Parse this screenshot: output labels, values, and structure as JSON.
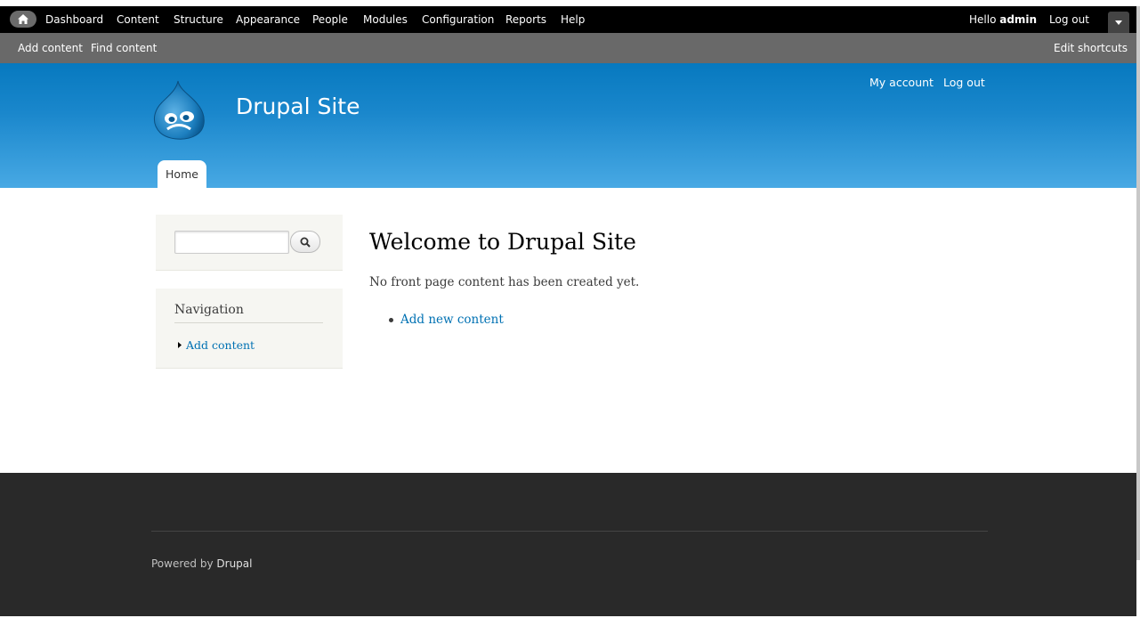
{
  "toolbar": {
    "menu": [
      "Dashboard",
      "Content",
      "Structure",
      "Appearance",
      "People",
      "Modules",
      "Configuration",
      "Reports",
      "Help"
    ],
    "hello_prefix": "Hello ",
    "user": "admin",
    "logout": "Log out"
  },
  "shortcuts": {
    "add_content": "Add content",
    "find_content": "Find content",
    "edit_shortcuts": "Edit shortcuts"
  },
  "header": {
    "site_name": "Drupal Site",
    "my_account": "My account",
    "logout": "Log out",
    "tab_home": "Home"
  },
  "sidebar": {
    "search_value": "",
    "navigation_title": "Navigation",
    "navigation_items": [
      "Add content"
    ]
  },
  "content": {
    "title": "Welcome to Drupal Site",
    "message": "No front page content has been created yet.",
    "link": "Add new content"
  },
  "footer": {
    "powered_by": "Powered by",
    "drupal": "Drupal"
  },
  "colors": {
    "toolbar": "#000000",
    "shortcuts": "#696969",
    "header_top": "#0779bf",
    "header_bottom": "#48a9e4",
    "link": "#0071b3",
    "footer": "#292929"
  }
}
